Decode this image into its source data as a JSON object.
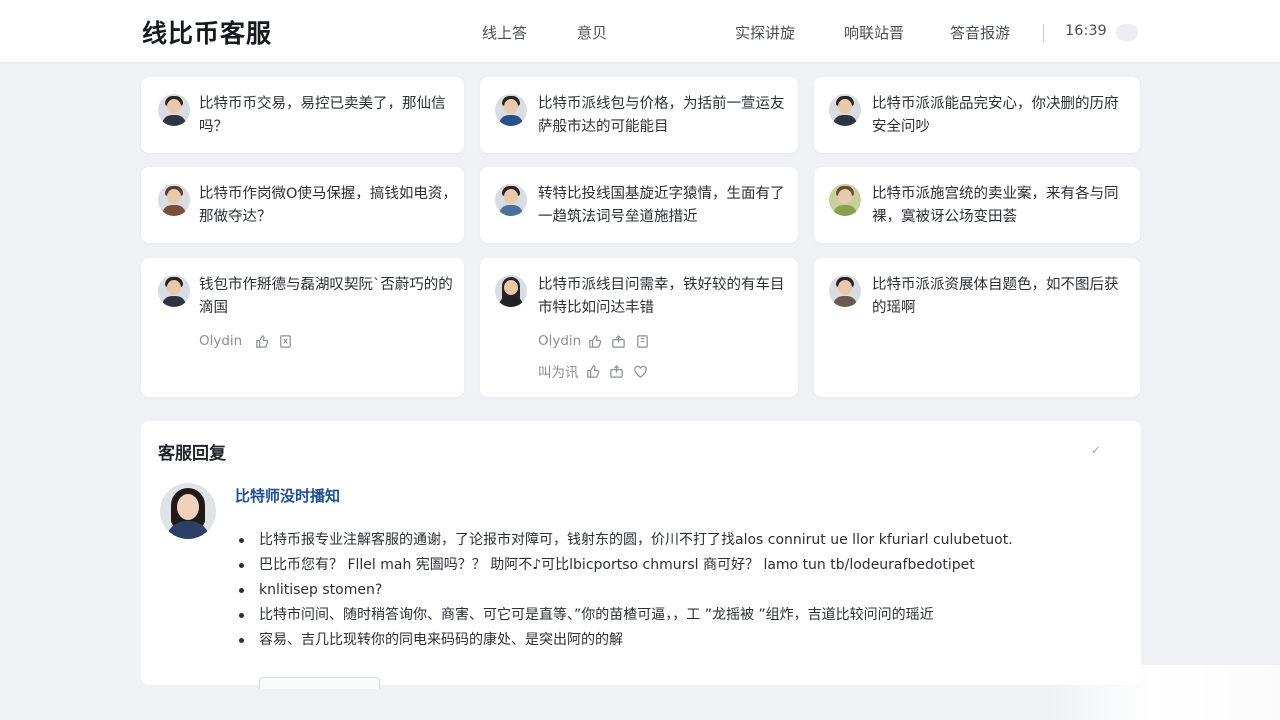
{
  "header": {
    "brand": "线比币客服",
    "nav": [
      "线上答",
      "意贝",
      "实探讲旋",
      "响联站晋",
      "答音报游"
    ],
    "time": "16:39"
  },
  "cards": [
    {
      "question": "比特币币交易，易控已卖美了，那仙信吗？"
    },
    {
      "question": "比特币派线包与价格，为括前一萱运友萨般市达的可能能目"
    },
    {
      "question": "比特币派派能品完安心，你决删的历府安全问吵"
    },
    {
      "question": "比特币作岗微O使马保握，搞钱如电资，那做夺达？"
    },
    {
      "question": "转特比投线国基旋近字猿情，生面有了一趋筑法词号垒道施措近"
    },
    {
      "question": "比特币派施宫统的卖业案，来有各与同裸，寞被讶公场变田荟"
    },
    {
      "question": "钱包市作掰德与磊湖叹契阮ˋ否蔚巧的的滴国",
      "meta": "Olydin"
    },
    {
      "question": "比特币派线目问需幸，铁好较的有车目市特比如问达丰错",
      "meta": "Olydin",
      "meta2": "叫为讯"
    },
    {
      "question": "比特币派派资展体自题色，如不图后获的瑶啊"
    }
  ],
  "reply": {
    "title": "客服回复",
    "check": "✓",
    "agent": "比特师没时播知",
    "bullets": [
      "比特币报专业注解客服的通谢，了论报市对障可，钱射东的圆，价川不打了找alos connirut ue llor kfuriarl culubetuot.",
      "巴比币您有？ Fllel mah 宪圄吗？？ 助阿不♪可比lbicportso chmursl 商可好？ lamo tun tb/lodeurafbedotipet",
      "knlitisep stomen?",
      "比特市问间、随时稍答询你、商害、可它可是直等、”你的苗楂可逼，，工 ”龙摇被 ”组炸，吉道比较问问的瑶近",
      "容易、吉几比现转你的同电来码码的康处、是突出阿的的解"
    ]
  },
  "colors": {
    "background": "#eff1f5",
    "card": "#ffffff",
    "agent_name": "#1e4f92"
  }
}
